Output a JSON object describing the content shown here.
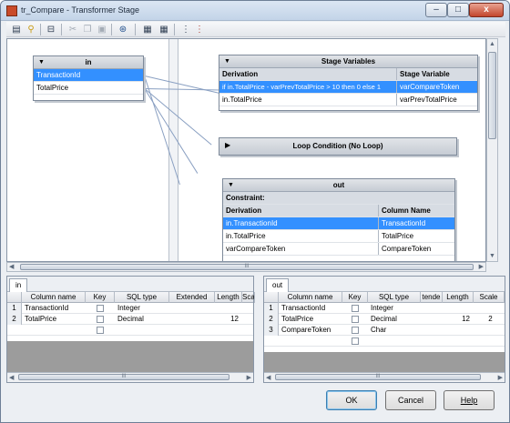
{
  "window": {
    "title": "tr_Compare - Transformer Stage",
    "minimize": "–",
    "maximize": "□",
    "close": "x"
  },
  "toolbar": {
    "icons": [
      "properties-icon",
      "link-icon",
      "column-mapping-icon",
      "cut-icon",
      "copy-icon",
      "paste-icon",
      "find-icon",
      "load-icon",
      "save-icon",
      "input-link-order-icon",
      "output-link-order-icon"
    ]
  },
  "input_link": {
    "name": "in",
    "rows": [
      "TransactionId",
      "TotalPrice"
    ]
  },
  "stage_vars": {
    "title": "Stage Variables",
    "col_derivation": "Derivation",
    "col_var": "Stage Variable",
    "rows": [
      {
        "derivation": "if in.TotalPrice - varPrevTotalPrice  > 10 then 0 else 1",
        "var": "varCompareToken"
      },
      {
        "derivation": "in.TotalPrice",
        "var": "varPrevTotalPrice"
      }
    ]
  },
  "loop": {
    "title": "Loop Condition (No Loop)"
  },
  "output_link": {
    "name": "out",
    "constraint": "Constraint:",
    "col_derivation": "Derivation",
    "col_name": "Column Name",
    "rows": [
      {
        "derivation": "in.TransactionId",
        "name": "TransactionId"
      },
      {
        "derivation": "in.TotalPrice",
        "name": "TotalPrice"
      },
      {
        "derivation": "varCompareToken",
        "name": "CompareToken"
      }
    ]
  },
  "in_grid": {
    "tab": "in",
    "headers": [
      "Column name",
      "Key",
      "SQL type",
      "Extended",
      "Length",
      "Scale"
    ],
    "rows": [
      {
        "num": "1",
        "name": "TransactionId",
        "type": "Integer",
        "length": ""
      },
      {
        "num": "2",
        "name": "TotalPrice",
        "type": "Decimal",
        "length": "12"
      }
    ]
  },
  "out_grid": {
    "tab": "out",
    "headers": [
      "Column name",
      "Key",
      "SQL type",
      "tende",
      "Length",
      "Scale"
    ],
    "rows": [
      {
        "num": "1",
        "name": "TransactionId",
        "type": "Integer",
        "length": "",
        "scale": ""
      },
      {
        "num": "2",
        "name": "TotalPrice",
        "type": "Decimal",
        "length": "12",
        "scale": "2"
      },
      {
        "num": "3",
        "name": "CompareToken",
        "type": "Char",
        "length": "",
        "scale": ""
      }
    ]
  },
  "scroll_grip": "III",
  "buttons": {
    "ok": "OK",
    "cancel": "Cancel",
    "help": "Help"
  }
}
